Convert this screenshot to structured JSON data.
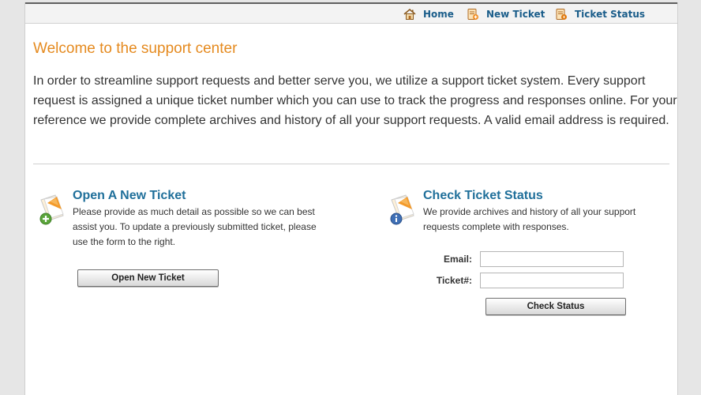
{
  "nav": {
    "home": "Home",
    "new_ticket": "New Ticket",
    "ticket_status": "Ticket Status"
  },
  "welcome": {
    "title": "Welcome to the support center",
    "body": "In order to streamline support requests and better serve you, we utilize a support ticket system. Every support request is assigned a unique ticket number which you can use to track the progress and responses online. For your reference we provide complete archives and history of all your support requests. A valid email address is required."
  },
  "open_ticket": {
    "title": "Open A New Ticket",
    "description": "Please provide as much detail as possible so we can best assist you. To update a previously submitted ticket, please use the form to the right.",
    "button": "Open New Ticket"
  },
  "check_status": {
    "title": "Check Ticket Status",
    "description": "We provide archives and history of all your support requests complete with responses.",
    "email_label": "Email:",
    "email_value": "",
    "ticket_label": "Ticket#:",
    "ticket_value": "",
    "button": "Check Status"
  },
  "colors": {
    "accent_orange": "#e58a1f",
    "link_blue": "#1a5d8a",
    "heading_blue": "#1f6f9a"
  },
  "icons": {
    "home": "home-icon",
    "new_ticket": "ticket-add-icon",
    "ticket_status": "ticket-status-icon",
    "open_ticket": "new-ticket-icon",
    "check_status": "ticket-info-icon"
  }
}
